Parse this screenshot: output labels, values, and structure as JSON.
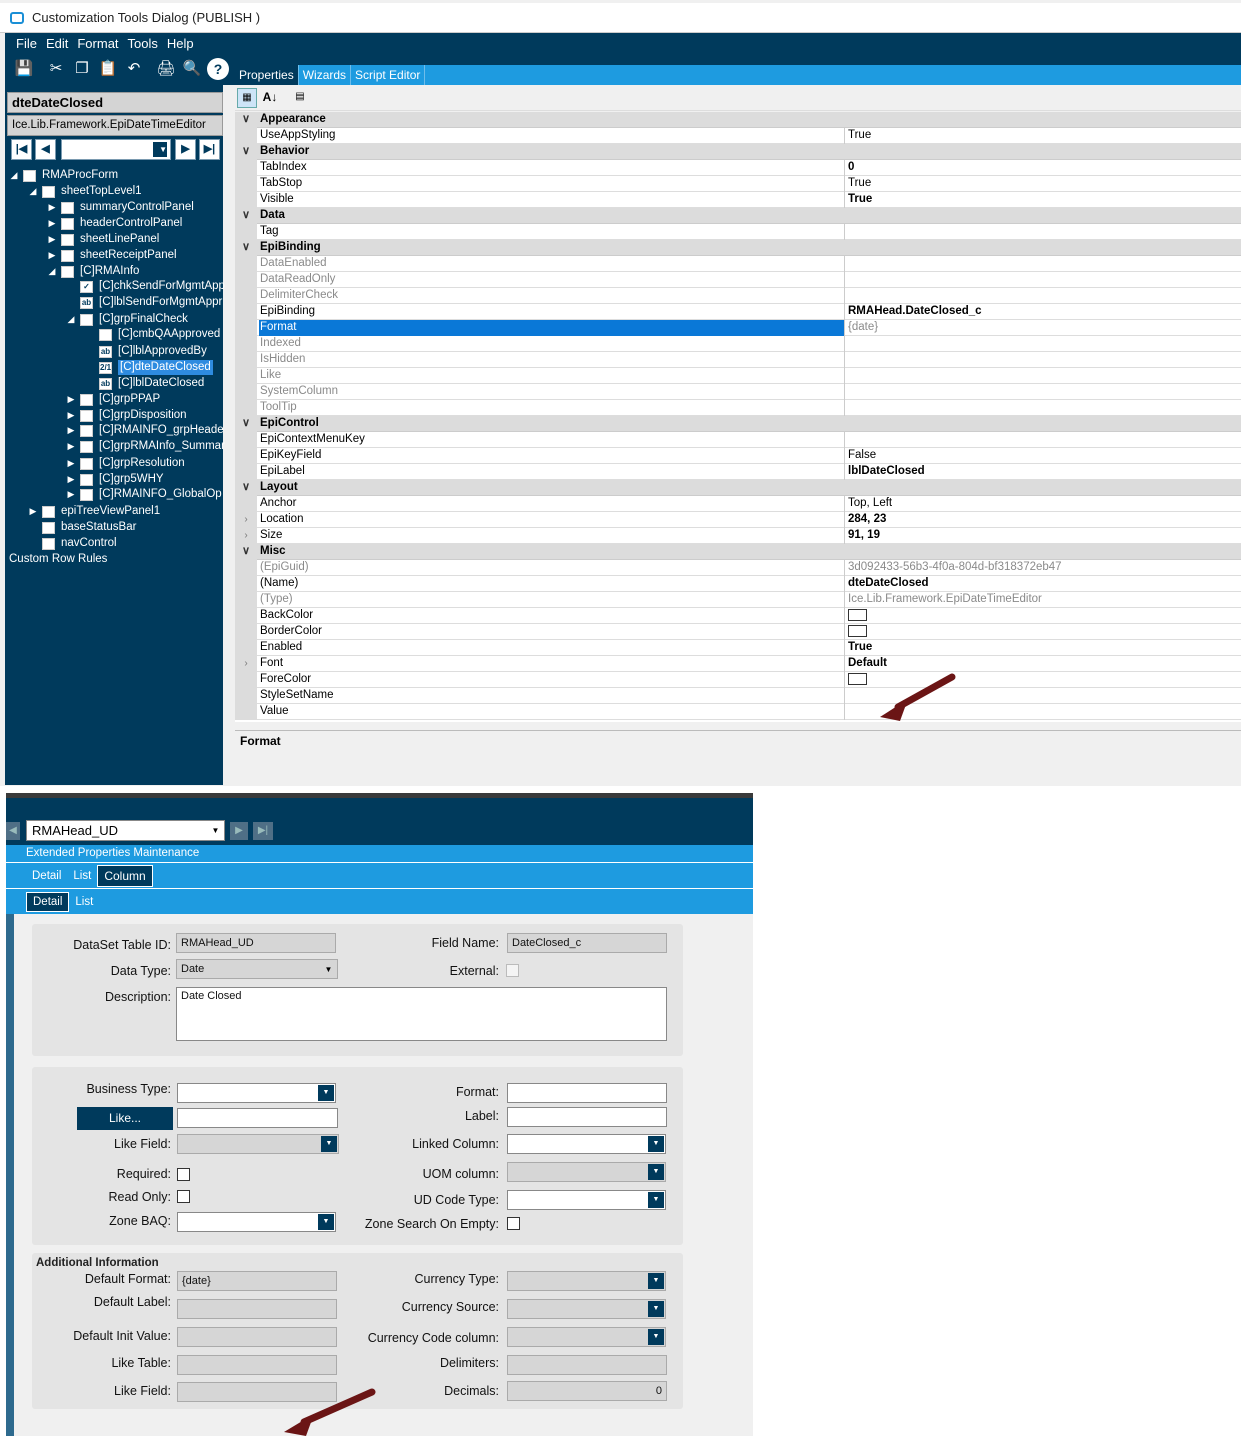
{
  "window": {
    "title": "Customization Tools Dialog  (PUBLISH )"
  },
  "menu": [
    "File",
    "Edit",
    "Format",
    "Tools",
    "Help"
  ],
  "left": {
    "selected_control": "dteDateClosed",
    "control_type": "Ice.Lib.Framework.EpiDateTimeEditor",
    "tree": [
      {
        "label": "RMAProcForm",
        "icon": "form"
      },
      {
        "label": "sheetTopLevel1",
        "icon": "sheet"
      },
      {
        "label": "summaryControlPanel",
        "icon": "sheet"
      },
      {
        "label": "headerControlPanel",
        "icon": "sheet"
      },
      {
        "label": "sheetLinePanel",
        "icon": "sheet"
      },
      {
        "label": "sheetReceiptPanel",
        "icon": "sheet"
      },
      {
        "label": "[C]RMAInfo",
        "icon": "sheet"
      },
      {
        "label": "[C]chkSendForMgmtApp",
        "icon": "check"
      },
      {
        "label": "[C]lblSendForMgmtAppr",
        "icon": "ab"
      },
      {
        "label": "[C]grpFinalCheck",
        "icon": "sheet"
      },
      {
        "label": "[C]cmbQAApproved",
        "icon": "combo"
      },
      {
        "label": "[C]lblApprovedBy",
        "icon": "ab"
      },
      {
        "label": "[C]dteDateClosed",
        "icon": "date"
      },
      {
        "label": "[C]lblDateClosed",
        "icon": "ab"
      },
      {
        "label": "[C]grpPPAP",
        "icon": "sheet"
      },
      {
        "label": "[C]grpDisposition",
        "icon": "sheet"
      },
      {
        "label": "[C]RMAINFO_grpHeade",
        "icon": "sheet"
      },
      {
        "label": "[C]grpRMAInfo_Summar",
        "icon": "sheet"
      },
      {
        "label": "[C]grpResolution",
        "icon": "sheet"
      },
      {
        "label": "[C]grp5WHY",
        "icon": "sheet"
      },
      {
        "label": "[C]RMAINFO_GlobalOp",
        "icon": "sheet"
      },
      {
        "label": "epiTreeViewPanel1",
        "icon": "sheet"
      },
      {
        "label": "baseStatusBar",
        "icon": "bar"
      },
      {
        "label": "navControl",
        "icon": "nav"
      },
      {
        "label": "Custom Row Rules",
        "icon": ""
      }
    ]
  },
  "right_tabs": [
    "Properties",
    "Wizards",
    "Script Editor"
  ],
  "properties": [
    {
      "cat": "Appearance"
    },
    {
      "name": "UseAppStyling",
      "value": "True"
    },
    {
      "cat": "Behavior"
    },
    {
      "name": "TabIndex",
      "value": "0",
      "bold": true
    },
    {
      "name": "TabStop",
      "value": "True"
    },
    {
      "name": "Visible",
      "value": "True",
      "bold": true
    },
    {
      "cat": "Data"
    },
    {
      "name": "Tag",
      "value": ""
    },
    {
      "cat": "EpiBinding"
    },
    {
      "name": "DataEnabled",
      "value": "",
      "dim": true
    },
    {
      "name": "DataReadOnly",
      "value": "",
      "dim": true
    },
    {
      "name": "DelimiterCheck",
      "value": "",
      "dim": true
    },
    {
      "name": "EpiBinding",
      "value": "RMAHead.DateClosed_c",
      "bold": true
    },
    {
      "name": "Format",
      "value": "{date}",
      "sel": true,
      "dimval": true
    },
    {
      "name": "Indexed",
      "value": "",
      "dim": true
    },
    {
      "name": "IsHidden",
      "value": "",
      "dim": true
    },
    {
      "name": "Like",
      "value": "",
      "dim": true
    },
    {
      "name": "SystemColumn",
      "value": "",
      "dim": true
    },
    {
      "name": "ToolTip",
      "value": "",
      "dim": true
    },
    {
      "cat": "EpiControl"
    },
    {
      "name": "EpiContextMenuKey",
      "value": ""
    },
    {
      "name": "EpiKeyField",
      "value": "False"
    },
    {
      "name": "EpiLabel",
      "value": "lblDateClosed",
      "bold": true
    },
    {
      "cat": "Layout"
    },
    {
      "name": "Anchor",
      "value": "Top, Left"
    },
    {
      "name": "Location",
      "value": "284, 23",
      "bold": true,
      "expand": true
    },
    {
      "name": "Size",
      "value": "91, 19",
      "bold": true,
      "expand": true
    },
    {
      "cat": "Misc"
    },
    {
      "name": "(EpiGuid)",
      "value": "3d092433-56b3-4f0a-804d-bf318372eb47",
      "dim": true,
      "dimval": true
    },
    {
      "name": "(Name)",
      "value": "dteDateClosed",
      "bold": true
    },
    {
      "name": "(Type)",
      "value": "Ice.Lib.Framework.EpiDateTimeEditor",
      "dim": true,
      "dimval": true
    },
    {
      "name": "BackColor",
      "value": "",
      "swatch": true
    },
    {
      "name": "BorderColor",
      "value": "",
      "swatch": true
    },
    {
      "name": "Enabled",
      "value": "True",
      "bold": true
    },
    {
      "name": "Font",
      "value": "Default",
      "bold": true,
      "expand": true
    },
    {
      "name": "ForeColor",
      "value": "",
      "swatch": true
    },
    {
      "name": "StyleSetName",
      "value": ""
    },
    {
      "name": "Value",
      "value": ""
    }
  ],
  "description_title": "Format",
  "ext": {
    "table_select": "RMAHead_UD",
    "header": "Extended Properties Maintenance",
    "tabs1": [
      "Detail",
      "List",
      "Column"
    ],
    "tabs2": [
      "Detail",
      "List"
    ],
    "dataset_label": "DataSet Table ID:",
    "dataset_value": "RMAHead_UD",
    "field_label": "Field Name:",
    "field_value": "DateClosed_c",
    "datatype_label": "Data Type:",
    "datatype_value": "Date",
    "external_label": "External:",
    "desc_label": "Description:",
    "desc_value": "Date Closed",
    "business_type_label": "Business Type:",
    "like_button": "Like...",
    "like_field_label": "Like Field:",
    "required_label": "Required:",
    "read_only_label": "Read Only:",
    "zone_baq_label": "Zone BAQ:",
    "format_label": "Format:",
    "label_label": "Label:",
    "linked_column_label": "Linked Column:",
    "uom_label": "UOM column:",
    "udcode_label": "UD Code Type:",
    "zone_search_label": "Zone Search On Empty:",
    "additional_title": "Additional Information",
    "default_format_label": "Default Format:",
    "default_format_value": "{date}",
    "default_label_label": "Default Label:",
    "default_init_label": "Default Init Value:",
    "like_table_label": "Like Table:",
    "like_field2_label": "Like Field:",
    "currency_type_label": "Currency Type:",
    "currency_source_label": "Currency Source:",
    "currency_code_label": "Currency Code column:",
    "delimiters_label": "Delimiters:",
    "decimals_label": "Decimals:",
    "decimals_value": "0"
  },
  "colors": {
    "navy": "#003a5c",
    "accent": "#1e9be0",
    "selection": "#0a78d7",
    "arrow": "#6b1515"
  }
}
